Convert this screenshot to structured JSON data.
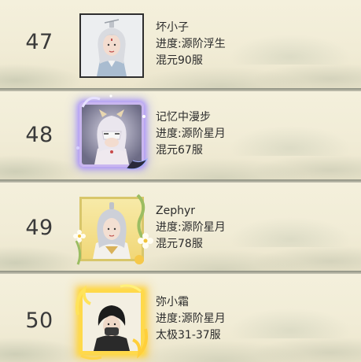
{
  "ranking": [
    {
      "rank": "47",
      "name": "坏小子",
      "progress": "进度:源阶浮生",
      "server": "混元90服",
      "frame": "plain"
    },
    {
      "rank": "48",
      "name": "记忆中漫步",
      "progress": "进度:源阶星月",
      "server": "混元67服",
      "frame": "cosmic"
    },
    {
      "rank": "49",
      "name": "Zephyr",
      "progress": "进度:源阶星月",
      "server": "混元78服",
      "frame": "flower"
    },
    {
      "rank": "50",
      "name": "弥小霜",
      "progress": "进度:源阶星月",
      "server": "太极31-37服",
      "frame": "fire"
    }
  ],
  "colors": {
    "row_bg": "#f1ecd6",
    "text": "#2c2c2c",
    "rank_text": "#3a3a3a",
    "divider": "#8a8d7e"
  }
}
